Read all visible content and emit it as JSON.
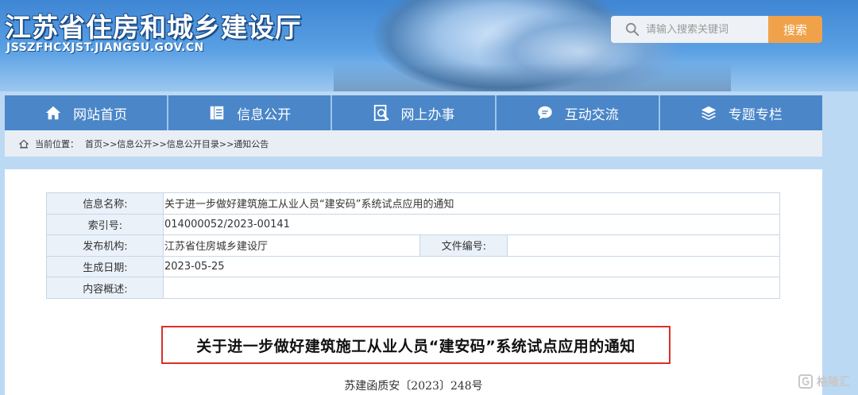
{
  "header": {
    "site_title": "江苏省住房和城乡建设厅",
    "site_url": "JSSZFHCXJST.JIANGSU.GOV.CN"
  },
  "search": {
    "placeholder": "请输入搜索关键词",
    "button_label": "搜索"
  },
  "nav": {
    "items": [
      {
        "label": "网站首页",
        "icon": "home-icon"
      },
      {
        "label": "信息公开",
        "icon": "document-icon"
      },
      {
        "label": "网上办事",
        "icon": "search-doc-icon"
      },
      {
        "label": "互动交流",
        "icon": "chat-icon"
      },
      {
        "label": "专题专栏",
        "icon": "layers-icon"
      }
    ]
  },
  "breadcrumb": {
    "label": "当前位置：",
    "path": "首页>>信息公开>>信息公开目录>>通知公告"
  },
  "info_table": {
    "name_label": "信息名称:",
    "name_value": "关于进一步做好建筑施工从业人员“建安码”系统试点应用的通知",
    "index_label": "索引号:",
    "index_value": "014000052/2023-00141",
    "publisher_label": "发布机构:",
    "publisher_value": "江苏省住房城乡建设厅",
    "file_no_label": "文件编号:",
    "file_no_value": "",
    "date_label": "生成日期:",
    "date_value": "2023-05-25",
    "summary_label": "内容概述:",
    "summary_value": ""
  },
  "document": {
    "title": "关于进一步做好建筑施工从业人员“建安码”系统试点应用的通知",
    "number": "苏建函质安〔2023〕248号"
  },
  "watermark": {
    "text": "格隆汇"
  },
  "colors": {
    "nav_bg": "#4a86c8",
    "search_btn": "#f0a24a",
    "title_border": "#d9302a"
  }
}
